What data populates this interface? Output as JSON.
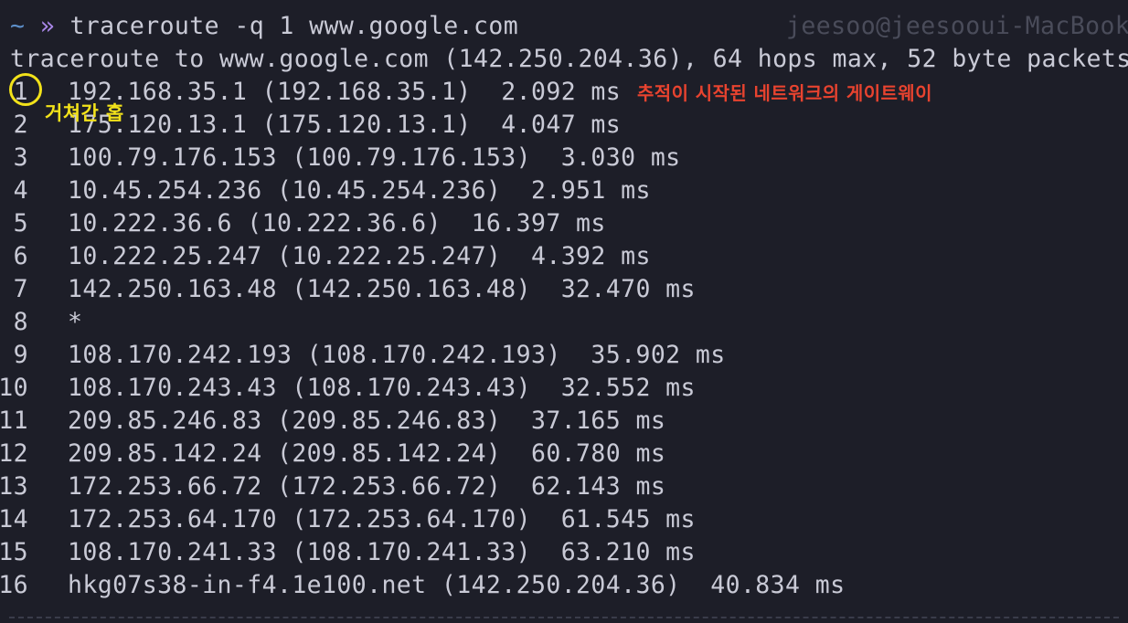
{
  "prompt": {
    "tilde": "~",
    "arrows": "»",
    "command": "traceroute -q 1 www.google.com",
    "right_prompt": "jeesoo@jeesooui-MacBookP"
  },
  "header_line": "traceroute to www.google.com (142.250.204.36), 64 hops max, 52 byte packets",
  "hops": [
    {
      "num": "1",
      "text": "192.168.35.1 (192.168.35.1)  2.092 ms"
    },
    {
      "num": "2",
      "text": "175.120.13.1 (175.120.13.1)  4.047 ms"
    },
    {
      "num": "3",
      "text": "100.79.176.153 (100.79.176.153)  3.030 ms"
    },
    {
      "num": "4",
      "text": "10.45.254.236 (10.45.254.236)  2.951 ms"
    },
    {
      "num": "5",
      "text": "10.222.36.6 (10.222.36.6)  16.397 ms"
    },
    {
      "num": "6",
      "text": "10.222.25.247 (10.222.25.247)  4.392 ms"
    },
    {
      "num": "7",
      "text": "142.250.163.48 (142.250.163.48)  32.470 ms"
    },
    {
      "num": "8",
      "text": "*"
    },
    {
      "num": "9",
      "text": "108.170.242.193 (108.170.242.193)  35.902 ms"
    },
    {
      "num": "10",
      "text": "108.170.243.43 (108.170.243.43)  32.552 ms"
    },
    {
      "num": "11",
      "text": "209.85.246.83 (209.85.246.83)  37.165 ms"
    },
    {
      "num": "12",
      "text": "209.85.142.24 (209.85.142.24)  60.780 ms"
    },
    {
      "num": "13",
      "text": "172.253.66.72 (172.253.66.72)  62.143 ms"
    },
    {
      "num": "14",
      "text": "172.253.64.170 (172.253.64.170)  61.545 ms"
    },
    {
      "num": "15",
      "text": "108.170.241.33 (108.170.241.33)  63.210 ms"
    },
    {
      "num": "16",
      "text": "hkg07s38-in-f4.1e100.net (142.250.204.36)  40.834 ms"
    }
  ],
  "annotations": {
    "hop_label": "거쳐간 홉",
    "gateway_label": "추적이 시작된 네트워크의 게이트웨이",
    "hop_color": "#f2e21a",
    "gateway_color": "#e8432f"
  }
}
